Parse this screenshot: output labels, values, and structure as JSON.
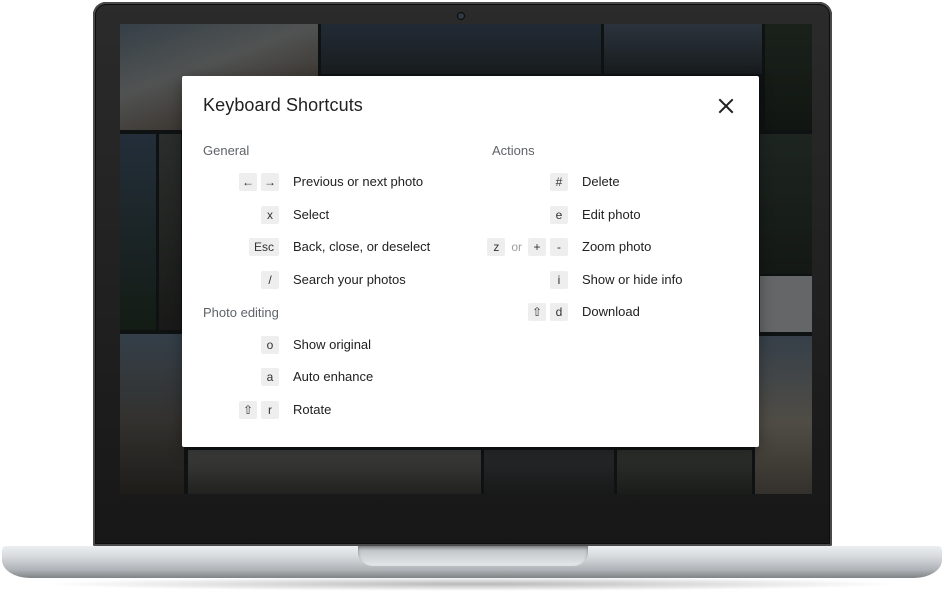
{
  "dialog": {
    "title": "Keyboard Shortcuts",
    "close_icon": "close-icon"
  },
  "sections": {
    "general": {
      "heading": "General",
      "rows": [
        {
          "keys": [
            "←",
            "→"
          ],
          "label": "Previous or next photo"
        },
        {
          "keys": [
            "x"
          ],
          "label": "Select"
        },
        {
          "keys": [
            "Esc"
          ],
          "label": "Back, close, or deselect"
        },
        {
          "keys": [
            "/"
          ],
          "label": "Search your photos"
        }
      ]
    },
    "photo_editing": {
      "heading": "Photo editing",
      "rows": [
        {
          "keys": [
            "o"
          ],
          "label": "Show original"
        },
        {
          "keys": [
            "a"
          ],
          "label": "Auto enhance"
        },
        {
          "keys": [
            "⇧",
            "r"
          ],
          "label": "Rotate"
        }
      ]
    },
    "actions": {
      "heading": "Actions",
      "rows": [
        {
          "keys": [
            "#"
          ],
          "label": "Delete"
        },
        {
          "keys": [
            "e"
          ],
          "label": "Edit photo"
        },
        {
          "keys": [
            "z",
            "+",
            "-"
          ],
          "separator": "or",
          "label": "Zoom photo"
        },
        {
          "keys": [
            "i"
          ],
          "label": "Show or hide info"
        },
        {
          "keys": [
            "⇧",
            "d"
          ],
          "label": "Download"
        }
      ]
    }
  },
  "colors": {
    "dialog_bg": "#ffffff",
    "key_bg": "#eeeeee",
    "heading_text": "#5f6368",
    "body_text": "#212121"
  }
}
